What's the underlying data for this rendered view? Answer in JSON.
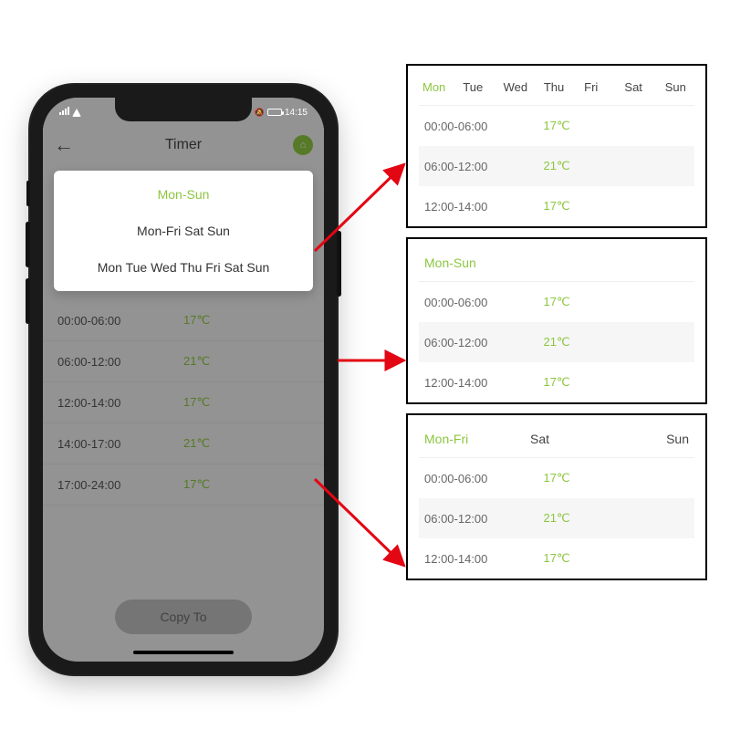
{
  "status_bar": {
    "time": "14:15",
    "silent_icon": "🔕"
  },
  "nav": {
    "title": "Timer",
    "back": "←",
    "home_icon": "⌂"
  },
  "popup": {
    "opt1": "Mon-Sun",
    "opt2": "Mon-Fri Sat Sun",
    "opt3": "Mon Tue Wed Thu Fri Sat Sun"
  },
  "phone_schedule": [
    {
      "time": "00:00-06:00",
      "temp": "17℃"
    },
    {
      "time": "06:00-12:00",
      "temp": "21℃"
    },
    {
      "time": "12:00-14:00",
      "temp": "17℃"
    },
    {
      "time": "14:00-17:00",
      "temp": "21℃"
    },
    {
      "time": "17:00-24:00",
      "temp": "17℃"
    }
  ],
  "copy_to": "Copy To",
  "panel1": {
    "days": [
      "Mon",
      "Tue",
      "Wed",
      "Thu",
      "Fri",
      "Sat",
      "Sun"
    ],
    "rows": [
      {
        "time": "00:00-06:00",
        "temp": "17℃"
      },
      {
        "time": "06:00-12:00",
        "temp": "21℃"
      },
      {
        "time": "12:00-14:00",
        "temp": "17℃"
      }
    ]
  },
  "panel2": {
    "header": "Mon-Sun",
    "rows": [
      {
        "time": "00:00-06:00",
        "temp": "17℃"
      },
      {
        "time": "06:00-12:00",
        "temp": "21℃"
      },
      {
        "time": "12:00-14:00",
        "temp": "17℃"
      }
    ]
  },
  "panel3": {
    "seg1": "Mon-Fri",
    "seg2": "Sat",
    "seg3": "Sun",
    "rows": [
      {
        "time": "00:00-06:00",
        "temp": "17℃"
      },
      {
        "time": "06:00-12:00",
        "temp": "21℃"
      },
      {
        "time": "12:00-14:00",
        "temp": "17℃"
      }
    ]
  }
}
